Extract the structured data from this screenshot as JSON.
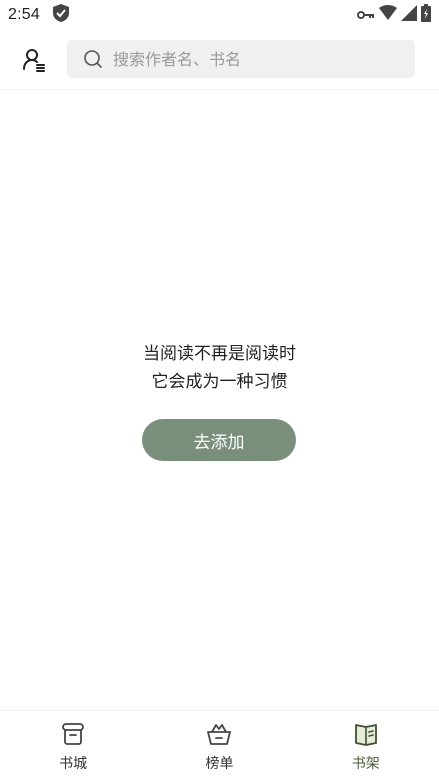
{
  "status_bar": {
    "time": "2:54",
    "icons": [
      "shield-icon",
      "vpn-key-icon",
      "wifi-icon",
      "signal-icon",
      "battery-icon"
    ]
  },
  "header": {
    "profile_icon": "user-list-icon",
    "search": {
      "placeholder": "搜索作者名、书名",
      "value": ""
    }
  },
  "empty_state": {
    "line1": "当阅读不再是阅读时",
    "line2": "它会成为一种习惯",
    "button_label": "去添加"
  },
  "bottom_nav": {
    "items": [
      {
        "label": "书城",
        "icon": "bookstore-icon",
        "active": false
      },
      {
        "label": "榜单",
        "icon": "ranking-basket-icon",
        "active": false
      },
      {
        "label": "书架",
        "icon": "bookshelf-icon",
        "active": true
      }
    ]
  },
  "colors": {
    "accent": "#7a8f7b",
    "active_nav": "#4a5a3a",
    "search_bg": "#f0f0f0"
  }
}
